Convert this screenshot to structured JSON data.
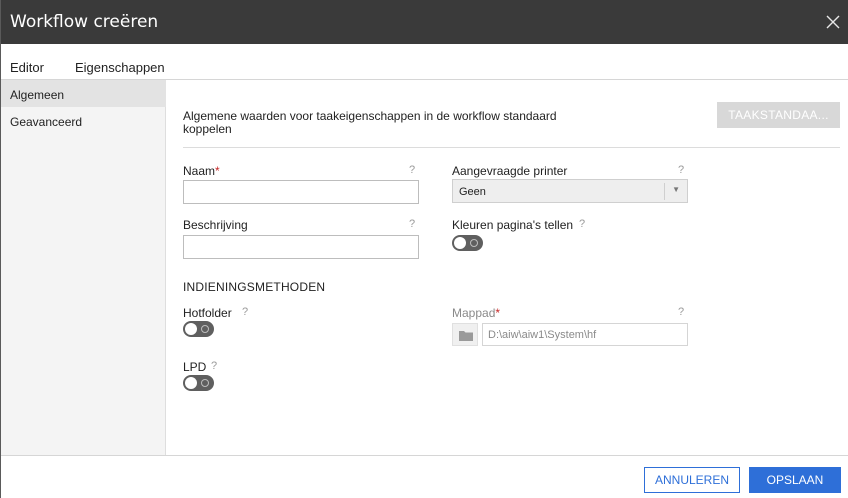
{
  "dialog": {
    "title": "Workflow creëren",
    "close_icon": "close-icon"
  },
  "tabs": [
    {
      "label": "Editor",
      "active": false
    },
    {
      "label": "Eigenschappen",
      "active": true
    }
  ],
  "sidebar": {
    "items": [
      {
        "label": "Algemeen",
        "active": true
      },
      {
        "label": "Geavanceerd",
        "active": false
      }
    ]
  },
  "main": {
    "description": "Algemene waarden voor taakeigenschappen in de workflow standaard koppelen",
    "defaults_button": "TAAKSTANDAA...",
    "help_glyph": "?",
    "name": {
      "label": "Naam",
      "required_mark": "*",
      "value": ""
    },
    "description_field": {
      "label": "Beschrijving",
      "value": ""
    },
    "printer": {
      "label": "Aangevraagde printer",
      "value": "Geen"
    },
    "color_pages": {
      "label": "Kleuren pagina's tellen",
      "on": false
    },
    "submission_methods": {
      "heading": "INDIENINGSMETHODEN",
      "hotfolder": {
        "label": "Hotfolder",
        "on": false
      },
      "folder_path": {
        "label": "Mappad",
        "required_mark": "*",
        "value": "D:\\aiw\\aiw1\\System\\hf"
      },
      "lpd": {
        "label": "LPD",
        "on": false
      }
    }
  },
  "footer": {
    "cancel_label": "ANNULEREN",
    "save_label": "OPSLAAN"
  },
  "colors": {
    "titlebar": "#3a3a3a",
    "accent": "#2e6fd8",
    "required": "#c62828",
    "disabled_button": "#d8d8d8"
  }
}
